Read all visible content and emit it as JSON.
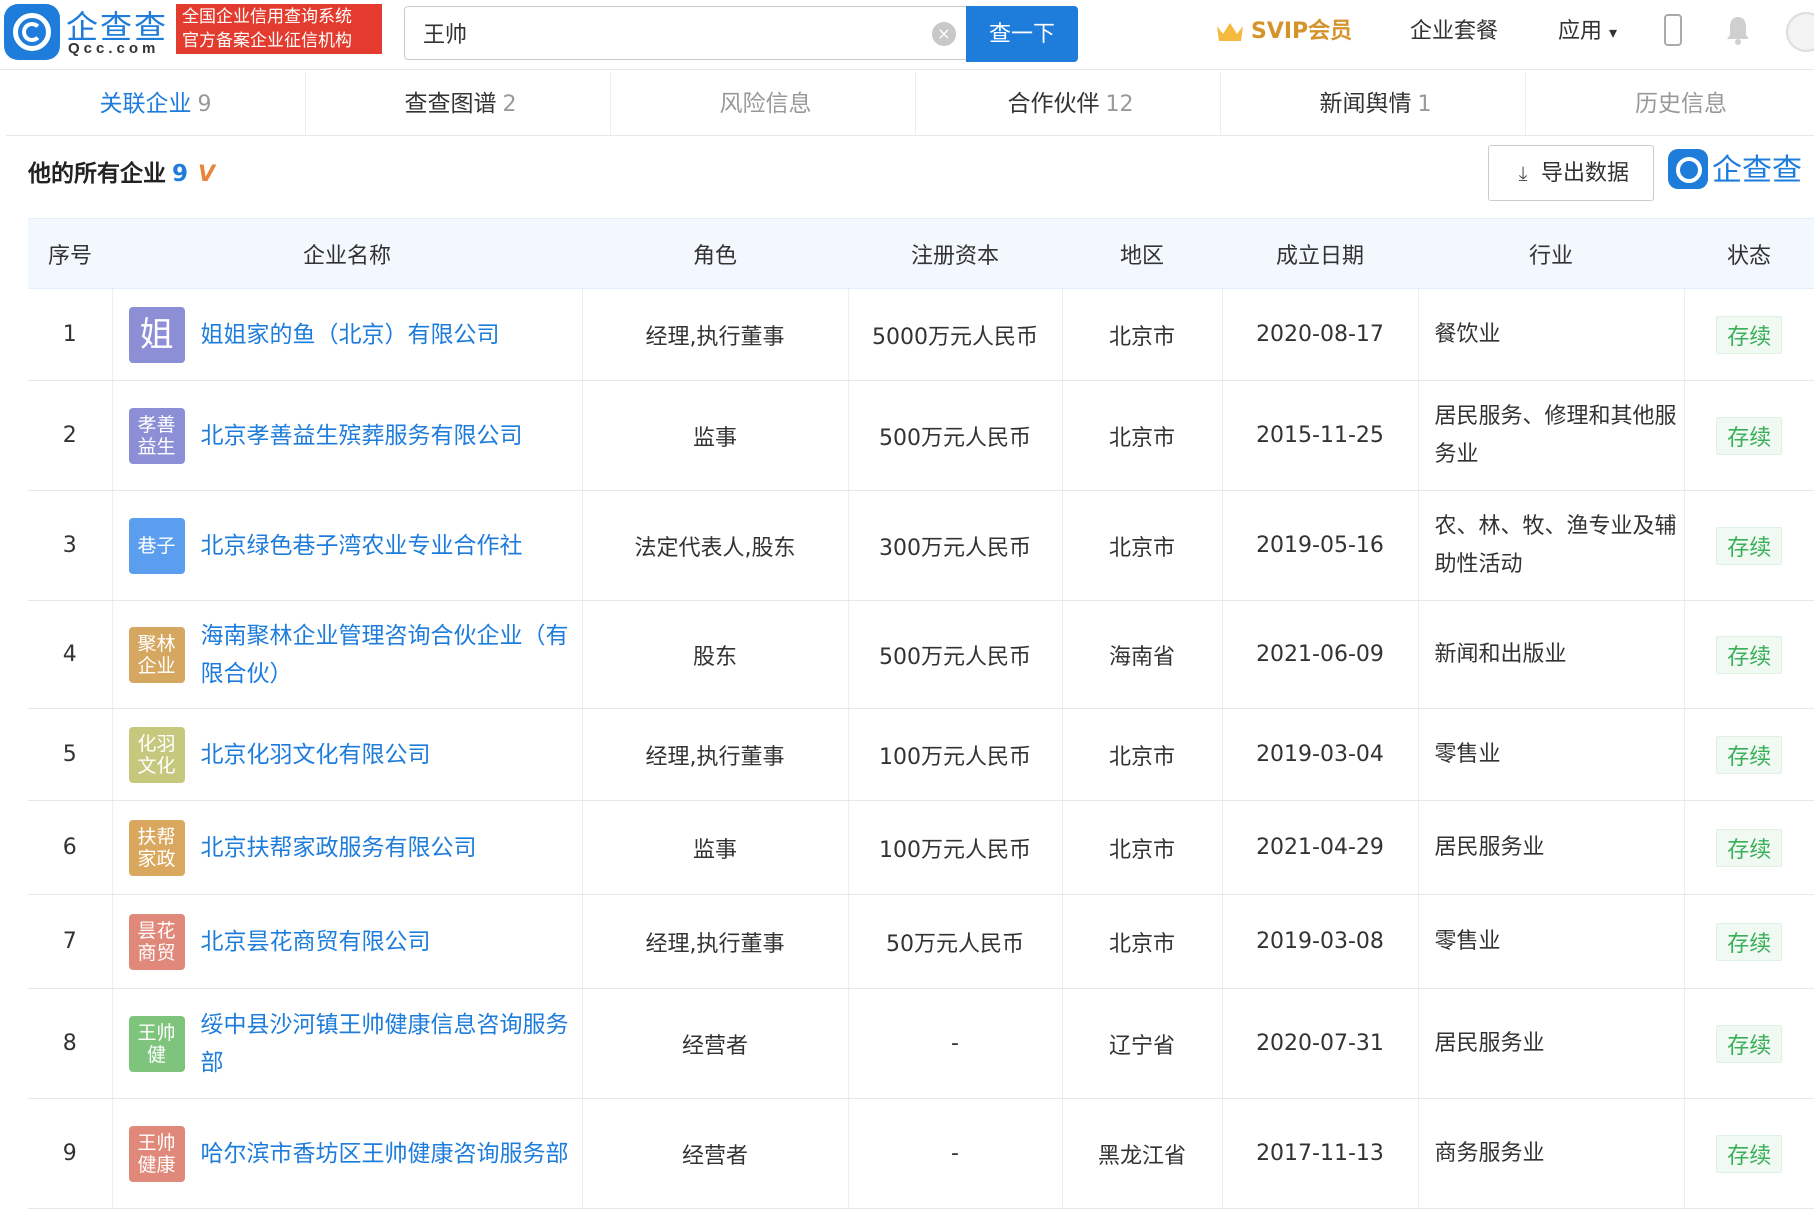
{
  "header": {
    "logo_text": "企查查",
    "logo_domain": "Qcc.com",
    "badge_line1": "全国企业信用查询系统",
    "badge_line2": "官方备案企业征信机构",
    "search_value": "王帅",
    "search_button": "查一下",
    "svip_label": "SVIP会员",
    "nav_package": "企业套餐",
    "nav_apps": "应用",
    "apps_caret": "▾",
    "clear_glyph": "×"
  },
  "tabs": [
    {
      "label": "关联企业",
      "count": "9"
    },
    {
      "label": "查查图谱",
      "count": "2"
    },
    {
      "label": "风险信息",
      "count": ""
    },
    {
      "label": "合作伙伴",
      "count": "12"
    },
    {
      "label": "新闻舆情",
      "count": "1"
    },
    {
      "label": "历史信息",
      "count": ""
    }
  ],
  "section": {
    "title": "他的所有企业",
    "count": "9",
    "vip_mark": "V",
    "export_label": "导出数据",
    "brand_text": "企查查"
  },
  "table": {
    "headers": [
      "序号",
      "企业名称",
      "角色",
      "注册资本",
      "地区",
      "成立日期",
      "行业",
      "状态"
    ],
    "rows": [
      {
        "no": "1",
        "logo": "姐",
        "logo_color": "#8c8fd6",
        "name": "姐姐家的鱼（北京）有限公司",
        "role": "经理,执行董事",
        "capital": "5000万元人民币",
        "region": "北京市",
        "date": "2020-08-17",
        "industry": "餐饮业",
        "status": "存续"
      },
      {
        "no": "2",
        "logo": "孝善益生",
        "logo_color": "#8c8fd6",
        "name": "北京孝善益生殡葬服务有限公司",
        "role": "监事",
        "capital": "500万元人民币",
        "region": "北京市",
        "date": "2015-11-25",
        "industry": "居民服务、修理和其他服务业",
        "status": "存续"
      },
      {
        "no": "3",
        "logo": "巷子",
        "logo_color": "#5b9ef0",
        "name": "北京绿色巷子湾农业专业合作社",
        "role": "法定代表人,股东",
        "capital": "300万元人民币",
        "region": "北京市",
        "date": "2019-05-16",
        "industry": "农、林、牧、渔专业及辅助性活动",
        "status": "存续"
      },
      {
        "no": "4",
        "logo": "聚林企业",
        "logo_color": "#d6a760",
        "name": "海南聚林企业管理咨询合伙企业（有限合伙）",
        "role": "股东",
        "capital": "500万元人民币",
        "region": "海南省",
        "date": "2021-06-09",
        "industry": "新闻和出版业",
        "status": "存续"
      },
      {
        "no": "5",
        "logo": "化羽文化",
        "logo_color": "#c6c87e",
        "name": "北京化羽文化有限公司",
        "role": "经理,执行董事",
        "capital": "100万元人民币",
        "region": "北京市",
        "date": "2019-03-04",
        "industry": "零售业",
        "status": "存续"
      },
      {
        "no": "6",
        "logo": "扶帮家政",
        "logo_color": "#d9a85e",
        "name": "北京扶帮家政服务有限公司",
        "role": "监事",
        "capital": "100万元人民币",
        "region": "北京市",
        "date": "2021-04-29",
        "industry": "居民服务业",
        "status": "存续"
      },
      {
        "no": "7",
        "logo": "昙花商贸",
        "logo_color": "#e0897a",
        "name": "北京昙花商贸有限公司",
        "role": "经理,执行董事",
        "capital": "50万元人民币",
        "region": "北京市",
        "date": "2019-03-08",
        "industry": "零售业",
        "status": "存续"
      },
      {
        "no": "8",
        "logo": "王帅健",
        "logo_color": "#7fc47d",
        "name": "绥中县沙河镇王帅健康信息咨询服务部",
        "role": "经营者",
        "capital": "-",
        "region": "辽宁省",
        "date": "2020-07-31",
        "industry": "居民服务业",
        "status": "存续"
      },
      {
        "no": "9",
        "logo": "王帅健康",
        "logo_color": "#e0897a",
        "name": "哈尔滨市香坊区王帅健康咨询服务部",
        "role": "经营者",
        "capital": "-",
        "region": "黑龙江省",
        "date": "2017-11-13",
        "industry": "商务服务业",
        "status": "存续"
      }
    ]
  }
}
